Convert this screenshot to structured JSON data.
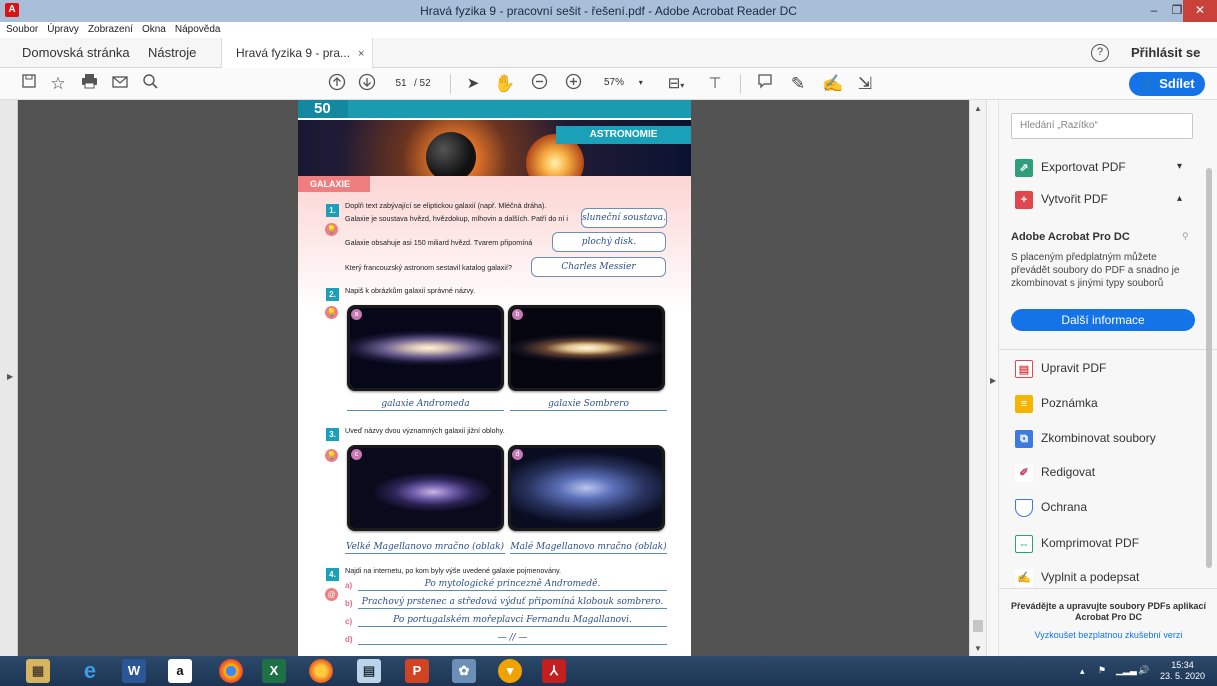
{
  "window": {
    "title": "Hravá fyzika 9 - pracovní sešit - řešení.pdf - Adobe Acrobat Reader DC",
    "minimize_icon": "–",
    "restore_icon": "❐",
    "close_icon": "✕"
  },
  "menu": [
    "Soubor",
    "Úpravy",
    "Zobrazení",
    "Okna",
    "Nápověda"
  ],
  "tabs": {
    "home": "Domovská stránka",
    "tools": "Nástroje",
    "document": "Hravá fyzika 9 - pra...",
    "close": "×"
  },
  "header": {
    "help": "?",
    "signin": "Přihlásit se"
  },
  "toolbar": {
    "page_current": "51",
    "page_total": "/ 52",
    "zoom": "57%",
    "share": "Sdílet"
  },
  "pdf": {
    "page_number": "50",
    "section": "ASTRONOMIE",
    "topic": "GALAXIE",
    "task1": {
      "num": "1.",
      "line1": "Doplň text zabývající se eliptickou galaxií (např. Mléčná dráha).",
      "line2": "Galaxie je soustava hvězd, hvězdokup, mlhovin a dalších. Patří do ní i",
      "answer1": "sluneční soustava.",
      "line3": "Galaxie obsahuje asi 150 miliard hvězd. Tvarem připomíná",
      "answer2": "plochý disk.",
      "line4": "Který francouzský astronom sestavil katalog galaxií?",
      "answer3": "Charles Messier"
    },
    "task2": {
      "num": "2.",
      "text": "Napiš k obrázkům galaxií správné názvy.",
      "tag_a": "a",
      "tag_b": "b",
      "answer_a": "galaxie Andromeda",
      "answer_b": "galaxie Sombrero"
    },
    "task3": {
      "num": "3.",
      "text": "Uveď názvy dvou významných galaxií jižní oblohy.",
      "tag_c": "c",
      "tag_d": "d",
      "answer_c": "Velké Magellanovo mračno (oblak)",
      "answer_d": "Malé Magellanovo mračno (oblak)"
    },
    "task4": {
      "num": "4.",
      "text": "Najdi na internetu, po kom byly výše uvedené galaxie pojmenovány.",
      "labels": [
        "a)",
        "b)",
        "c)",
        "d)"
      ],
      "answers": [
        "Po mytologické princezně Andromedě.",
        "Prachový prstenec a středová výduť připomíná klobouk sombrero.",
        "Po portugalském mořeplavci Fernandu Magallanovi.",
        "— // —"
      ]
    }
  },
  "rightpane": {
    "search_placeholder": "Hledání „Razítko“",
    "export": "Exportovat PDF",
    "create": "Vytvořit PDF",
    "pro_title": "Adobe Acrobat Pro DC",
    "pro_desc": "S placeným předplatným můžete převádět soubory do PDF a snadno je zkombinovat s jinými typy souborů",
    "more_info": "Další informace",
    "tools": [
      "Upravit PDF",
      "Poznámka",
      "Zkombinovat soubory",
      "Redigovat",
      "Ochrana",
      "Komprimovat PDF",
      "Vyplnit a podepsat"
    ],
    "promo": "Převádějte a upravujte soubory PDFs aplikací Acrobat Pro DC",
    "trial": "Vyzkoušet bezplatnou zkušební verzi"
  },
  "taskbar": {
    "time": "15:34",
    "date": "23. 5. 2020"
  },
  "colors": {
    "accent": "#1473e6",
    "teal": "#1aa0b8",
    "pink": "#ef7e80"
  }
}
